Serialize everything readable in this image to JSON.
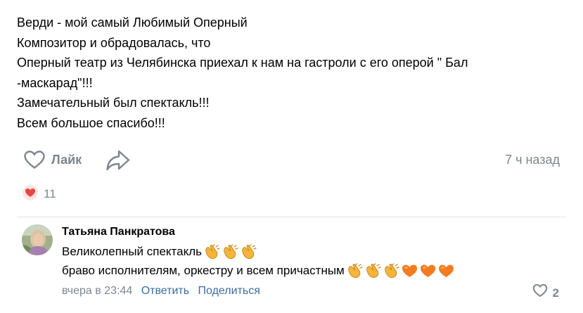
{
  "post": {
    "lines": [
      "Верди - мой самый Любимый Оперный",
      "Композитор и обрадовалась, что",
      "Оперный театр из Челябинска приехал к нам на гастроли с его оперой \" Бал",
      "-маскарад\"!!!",
      "Замечательный был спектакль!!!",
      "Всем большое спасибо!!!"
    ]
  },
  "actions": {
    "like_label": "Лайк",
    "timestamp": "7 ч назад"
  },
  "reactions": {
    "count": "11"
  },
  "comment": {
    "author": "Татьяна Панкратова",
    "line1": "Великолепный спектакль",
    "line2": "браво исполнителям, оркестру и всем причастным",
    "date": "вчера в 23:44",
    "reply_label": "Ответить",
    "share_label": "Поделиться",
    "like_count": "2"
  },
  "colors": {
    "muted": "#7b8691",
    "link": "#3a6ea5",
    "reaction_red": "#e64646",
    "divider": "#e3e4e8"
  },
  "icons": {
    "like": "heart-outline-icon",
    "share": "share-arrow-icon",
    "reaction": "heart-filled-icon",
    "clap": "clapping-hands-emoji",
    "orange_heart": "orange-heart-emoji"
  }
}
